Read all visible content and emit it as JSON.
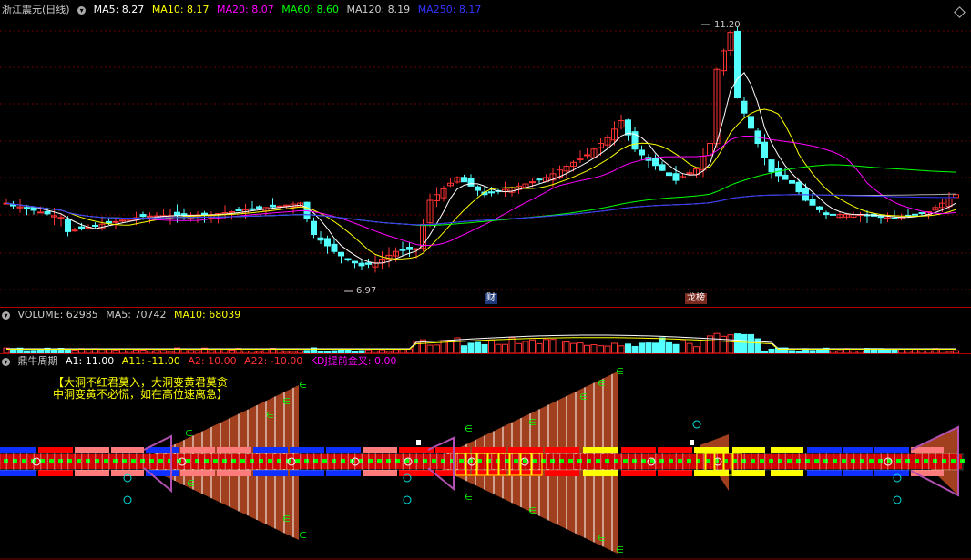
{
  "main": {
    "title": "浙江震元(日线)",
    "ma": [
      {
        "label": "MA5: 8.27",
        "color": "#ffffff"
      },
      {
        "label": "MA10: 8.17",
        "color": "#ffff00"
      },
      {
        "label": "MA20: 8.07",
        "color": "#ff00ff"
      },
      {
        "label": "MA60: 8.60",
        "color": "#00ff00"
      },
      {
        "label": "MA120: 8.19",
        "color": "#cccccc"
      },
      {
        "label": "MA250: 8.17",
        "color": "#3333ff"
      }
    ],
    "high_label": "11.20",
    "low_label": "6.97",
    "tag_cai": "财",
    "tag_longhu": "龙榜",
    "price_range": [
      6.6,
      11.4
    ]
  },
  "volume": {
    "label": "VOLUME: 62985",
    "ma5": "MA5: 70742",
    "ma10": "MA10: 68039"
  },
  "indicator": {
    "title": "鼎牛周期",
    "a1": "A1: 11.00",
    "a11": "A11: -11.00",
    "a2": "A2: 10.00",
    "a22": "A22: -10.00",
    "kdj": "KDJ提前金叉: 0.00",
    "note_line1": "【大洞不红君莫入，大洞变黄君莫贪",
    "note_line2": "  中洞变黄不必慌，如在高位速离急】"
  },
  "colors": {
    "up": "#ff3232",
    "down": "#54ffff",
    "grid": "#7a0000",
    "sep": "#b00000"
  }
}
